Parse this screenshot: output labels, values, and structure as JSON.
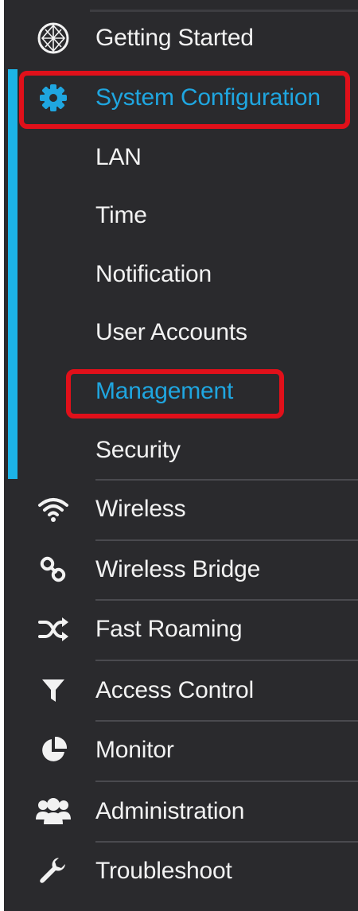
{
  "sidebar": {
    "items": [
      {
        "label": "Getting Started",
        "icon": "getting-started-icon"
      },
      {
        "label": "System Configuration",
        "icon": "gear-icon"
      },
      {
        "label": "LAN"
      },
      {
        "label": "Time"
      },
      {
        "label": "Notification"
      },
      {
        "label": "User Accounts"
      },
      {
        "label": "Management"
      },
      {
        "label": "Security"
      },
      {
        "label": "Wireless",
        "icon": "wifi-icon"
      },
      {
        "label": "Wireless Bridge",
        "icon": "link-icon"
      },
      {
        "label": "Fast Roaming",
        "icon": "shuffle-icon"
      },
      {
        "label": "Access Control",
        "icon": "filter-icon"
      },
      {
        "label": "Monitor",
        "icon": "pie-chart-icon"
      },
      {
        "label": "Administration",
        "icon": "users-icon"
      },
      {
        "label": "Troubleshoot",
        "icon": "wrench-icon"
      }
    ]
  },
  "colors": {
    "background": "#2a2a2d",
    "accent": "#1cb3e6",
    "active_text": "#1fa6e0",
    "highlight": "#e0101a"
  }
}
